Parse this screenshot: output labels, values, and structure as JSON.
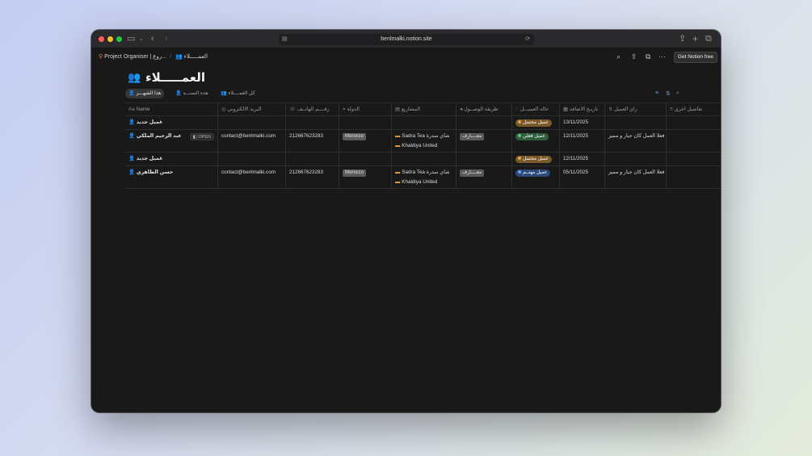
{
  "browser": {
    "url": "benlmalki.notion.site"
  },
  "breadcrumb": {
    "workspace": "Project Organiser | روع...",
    "separator": "/",
    "page": "العمـــــلاء"
  },
  "topbar": {
    "get_notion_label": "Get Notion free"
  },
  "page": {
    "title": "العمـــــلاء"
  },
  "views": [
    {
      "label": "هذا الشهـــر",
      "active": true
    },
    {
      "label": "هذه السنـــة",
      "active": false
    },
    {
      "label": "كل العمــــلاء",
      "active": false
    }
  ],
  "columns": [
    "Name",
    "البريد الالكتروني",
    "رقــــم الهاتــف",
    "الدولة",
    "المشاريع",
    "طريقة الوصــول",
    "حالة العميـــل",
    "تاريـخ الاضافة",
    "راي العميل",
    "تفاصيل اخرى"
  ],
  "open_label": "OPEN",
  "rows": [
    {
      "name": "عميل جديد",
      "email": "",
      "phone": "",
      "country": "",
      "projects": [],
      "source": "",
      "status": "عميل محتمل",
      "date": "13/11/2025",
      "review": ""
    },
    {
      "name": "عبد الرحيم الملكي",
      "email": "contact@benlmalki.com",
      "phone": "212667623283",
      "country": "Morocco",
      "projects": [
        "Sadra Tea شاي سدرة",
        "Khaldiya United"
      ],
      "source": "معــــارف",
      "status": "عميل فعلي",
      "date": "12/11/2025",
      "review": "فعلا العمل كان جبار و مميز"
    },
    {
      "name": "عميل جديد",
      "email": "",
      "phone": "",
      "country": "",
      "projects": [],
      "source": "",
      "status": "عميل محتمل",
      "date": "12/11/2025",
      "review": ""
    },
    {
      "name": "حسن الطاهري",
      "email": "contact@benlmalki.com",
      "phone": "212667623283",
      "country": "Morocco",
      "projects": [
        "Sadra Tea شاي سدرة",
        "Khaldiya United"
      ],
      "source": "معــــارف",
      "status": "عميل مهتــم",
      "date": "05/11/2025",
      "review": "فعلا العمل كان جبار و مميز"
    }
  ],
  "status_colors": {
    "عميل محتمل": "#7a5a2a",
    "عميل فعلي": "#2f5e3e",
    "عميل مهتــم": "#2c4a7a"
  },
  "status_dots": {
    "عميل محتمل": "#e0a24a",
    "عميل فعلي": "#5fc27a",
    "عميل مهتــم": "#6aa0ee"
  },
  "icons": {
    "workspace": "link-icon",
    "page": "people-icon",
    "search": "search-icon",
    "share": "share-icon",
    "duplicate": "duplicate-icon",
    "more": "more-icon",
    "filter": "filter-icon",
    "sort": "sort-icon"
  }
}
